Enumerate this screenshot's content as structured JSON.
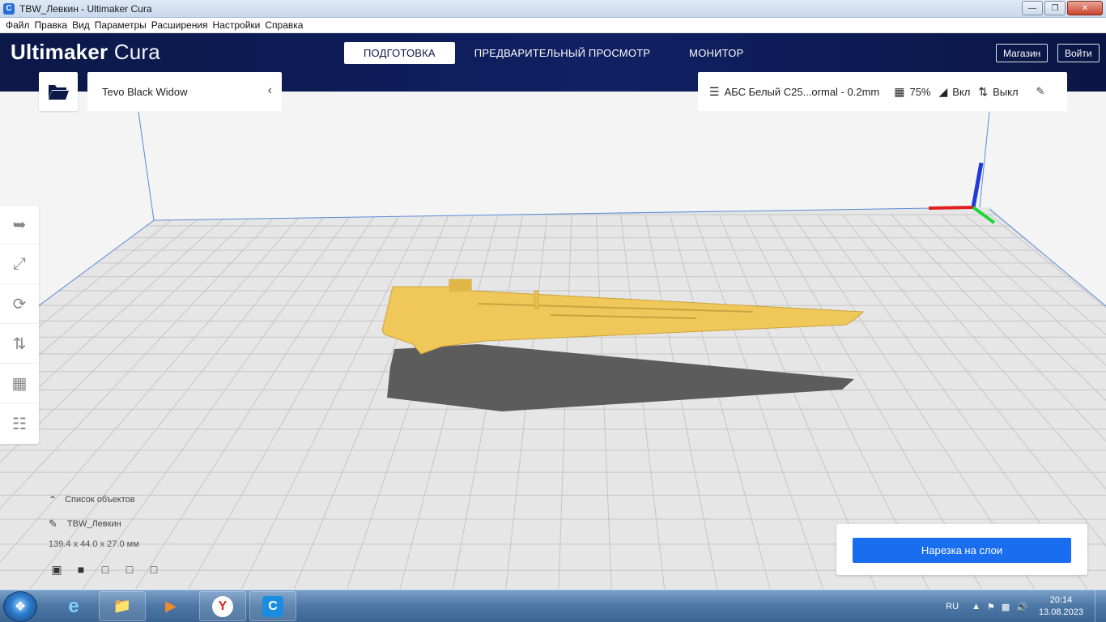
{
  "window": {
    "title": "TBW_Левкин - Ultimaker Cura",
    "app_icon": "cura-icon",
    "controls": [
      "minimize",
      "maximize",
      "close"
    ]
  },
  "menubar": {
    "items": [
      "Файл",
      "Правка",
      "Вид",
      "Параметры",
      "Расширения",
      "Настройки",
      "Справка"
    ]
  },
  "header": {
    "brand": "Ultimaker",
    "product": "Cura",
    "tabs": [
      {
        "label": "ПОДГОТОВКА",
        "active": true
      },
      {
        "label": "ПРЕДВАРИТЕЛЬНЫЙ ПРОСМОТР",
        "active": false
      },
      {
        "label": "МОНИТОР",
        "active": false
      }
    ],
    "marketplace_label": "Магазин",
    "signin_label": "Войти"
  },
  "toolbar": {
    "open_icon": "folder-open-icon",
    "printer_name": "Tevo Black Widow",
    "material_profile": "АБС Белый С25...ormal - 0.2mm",
    "infill": "75%",
    "support": "Вкл",
    "adhesion": "Выкл"
  },
  "tools": [
    {
      "name": "move-tool",
      "icon": "move-icon"
    },
    {
      "name": "scale-tool",
      "icon": "scale-icon"
    },
    {
      "name": "rotate-tool",
      "icon": "rotate-icon"
    },
    {
      "name": "mirror-tool",
      "icon": "mirror-icon"
    },
    {
      "name": "per-model-settings-tool",
      "icon": "per-model-settings-icon"
    },
    {
      "name": "support-blocker-tool",
      "icon": "support-blocker-icon"
    }
  ],
  "object_list": {
    "header": "Список объектов",
    "object_name": "TBW_Левкин",
    "dimensions": "139.4 x 44.0 x 27.0 мм"
  },
  "slice": {
    "button_label": "Нарезка на слои"
  },
  "taskbar": {
    "language": "RU",
    "time": "20:14",
    "date": "13.08.2023",
    "apps": [
      "internet-explorer",
      "file-explorer",
      "media-player",
      "yandex-browser",
      "ultimaker-cura"
    ]
  },
  "colors": {
    "header_bg": "#0b1848",
    "accent_blue": "#196ef0",
    "model_yellow": "#f0c85a",
    "shadow_gray": "#555555"
  }
}
